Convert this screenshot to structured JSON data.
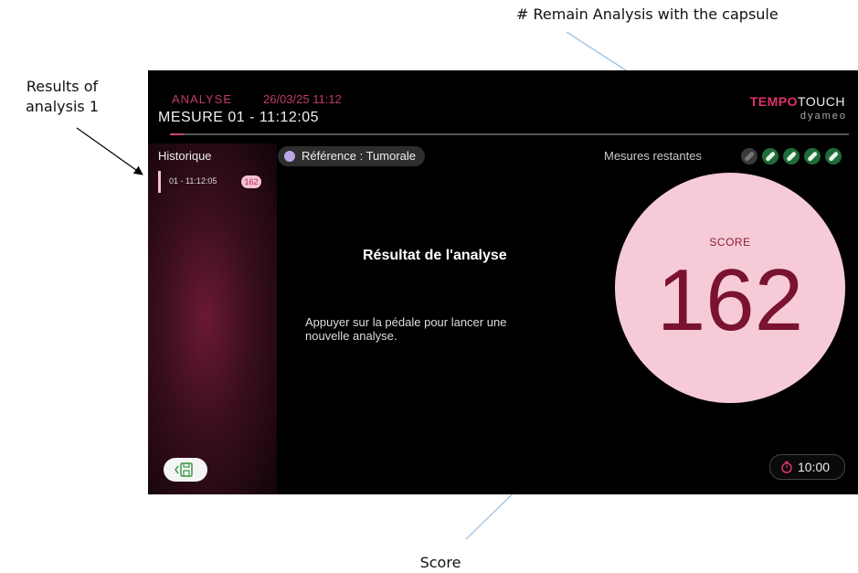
{
  "annotations": {
    "results_label": "Results of analysis 1",
    "remain_label": "# Remain Analysis with the capsule",
    "score_label": "Score"
  },
  "header": {
    "section": "ANALYSE",
    "datetime": "26/03/25 11:12",
    "measure": "MESURE 01 - 11:12:05",
    "brand_primary": "TEMPO",
    "brand_secondary": "TOUCH",
    "brand_sub": "dyameo",
    "progress": 0.02
  },
  "sidebar": {
    "title": "Historique",
    "items": [
      {
        "label": "01 - 11:12:05",
        "score": "162"
      }
    ],
    "save_icon": "save-icon"
  },
  "reference": {
    "label": "Référence : Tumorale",
    "dot_color": "#b9a7e8"
  },
  "remaining": {
    "label": "Mesures restantes",
    "used": 1,
    "total": 5
  },
  "result": {
    "title": "Résultat de l'analyse",
    "instruction": "Appuyer sur la pédale pour lancer une nouvelle analyse."
  },
  "score": {
    "label": "SCORE",
    "value": "162"
  },
  "timer": {
    "icon": "stopwatch-icon",
    "value": "10:00"
  },
  "colors": {
    "accent": "#e0306d",
    "score_bg": "#f6cbd7",
    "score_text": "#7a1232"
  }
}
